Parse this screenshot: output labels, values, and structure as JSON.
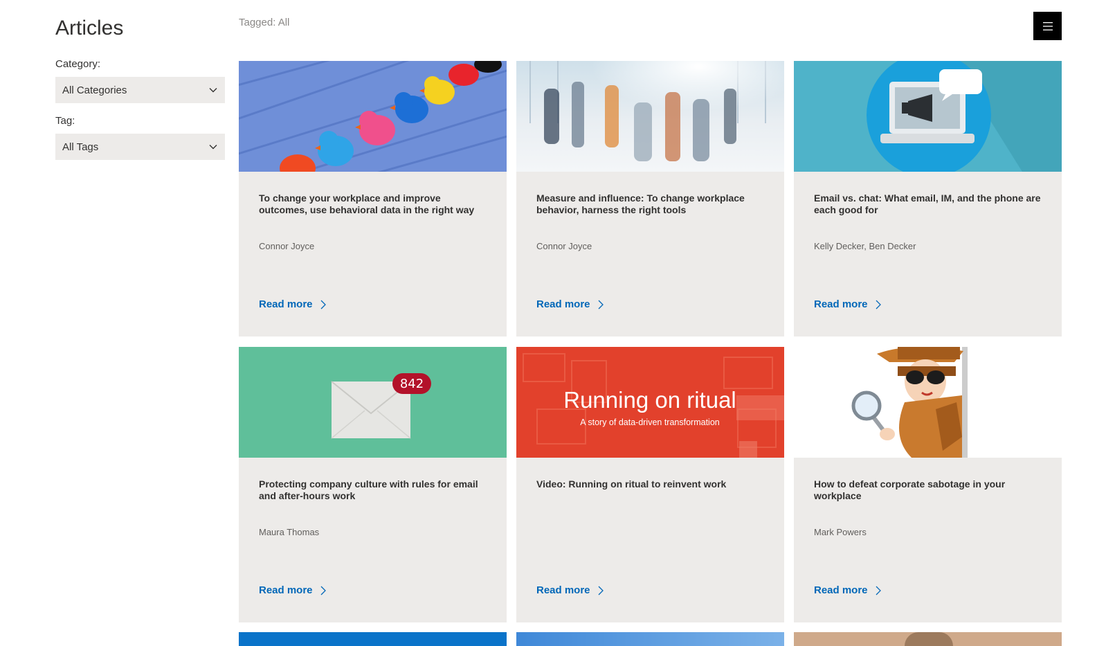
{
  "sidebar": {
    "title": "Articles",
    "category_label": "Category:",
    "category_value": "All Categories",
    "tag_label": "Tag:",
    "tag_value": "All Tags"
  },
  "header": {
    "tagged_text": "Tagged: All",
    "menu_icon": "hamburger-menu-icon"
  },
  "articles": [
    {
      "title": "To change your workplace and improve outcomes, use behavioral data in the right way",
      "author": "Connor Joyce",
      "read_more": "Read more",
      "image": "rubber-ducks-photo"
    },
    {
      "title": "Measure and influence: To change workplace behavior, harness the right tools",
      "author": "Connor Joyce",
      "read_more": "Read more",
      "image": "blurred-commuters-photo"
    },
    {
      "title": "Email vs. chat: What email, IM, and the phone are each good for",
      "author": "Kelly Decker, Ben Decker",
      "read_more": "Read more",
      "image": "laptop-megaphone-illustration"
    },
    {
      "title": "Protecting company culture with rules for email and after-hours work",
      "author": "Maura Thomas",
      "read_more": "Read more",
      "image": "envelope-notification-photo",
      "badge": "842"
    },
    {
      "title": "Video: Running on ritual to reinvent work",
      "author": "",
      "read_more": "Read more",
      "image": "running-on-ritual-banner",
      "banner_title": "Running on ritual",
      "banner_subtitle": "A story of data-driven transformation"
    },
    {
      "title": "How to defeat corporate sabotage in your workplace",
      "author": "Mark Powers",
      "read_more": "Read more",
      "image": "detective-magnifier-illustration"
    }
  ],
  "colors": {
    "card_bg": "#edebe9",
    "link": "#0067b8",
    "menu_bg": "#000000"
  }
}
